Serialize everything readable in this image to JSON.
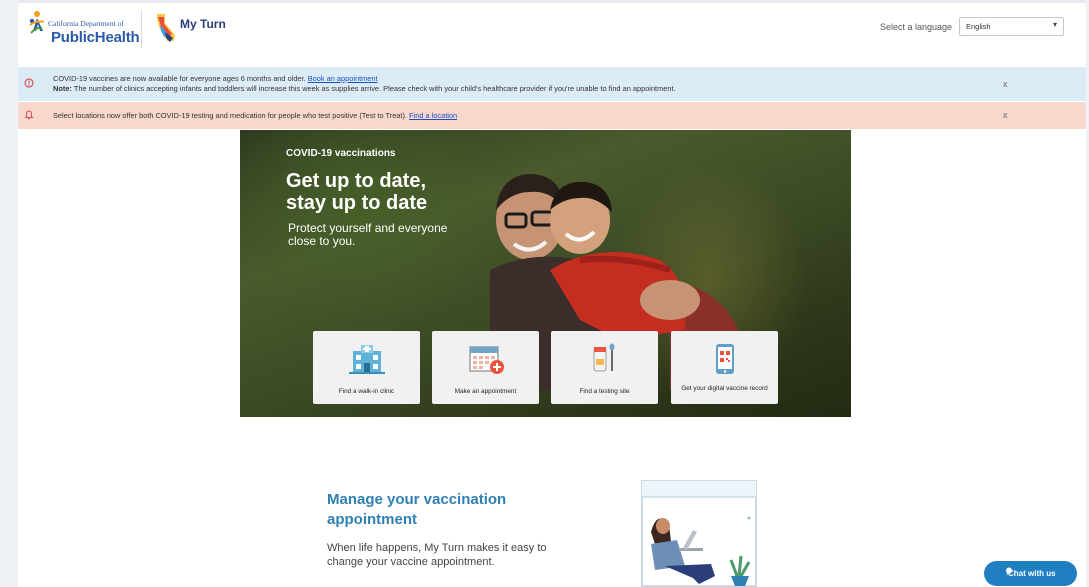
{
  "header": {
    "cdph_small": "California Department of",
    "cdph_big": "PublicHealth",
    "app_name": "My Turn",
    "language_label": "Select a language",
    "language_value": "English"
  },
  "alerts": [
    {
      "icon": "alert-circle-icon",
      "line1_text": "COVID-19 vaccines are now available for everyone ages 6 months and older.",
      "line1_link": "Book an appointment",
      "line2_bold": "Note:",
      "line2_text": "The number of clinics accepting infants and toddlers will increase this week as supplies arrive. Please check with your child's healthcare provider if you're unable to find an appointment.",
      "close": "x"
    },
    {
      "icon": "bell-icon",
      "text": "Select locations now offer both COVID-19 testing and medication for people who test positive (Test to Treat).",
      "link": "Find a location",
      "close": "x"
    }
  ],
  "hero": {
    "eyebrow": "COVID-19 vaccinations",
    "title": "Get up to date,\nstay up to date",
    "subtitle": "Protect yourself and everyone\nclose to you.",
    "actions": [
      {
        "label": "Find a walk-in clinic",
        "icon": "clinic-building-icon"
      },
      {
        "label": "Make an appointment",
        "icon": "calendar-add-icon"
      },
      {
        "label": "Find a testing site",
        "icon": "test-tube-icon"
      },
      {
        "label": "Get your digital vaccine record",
        "icon": "qr-phone-icon"
      }
    ]
  },
  "manage": {
    "title": "Manage your vaccination\nappointment",
    "text": "When life happens, My Turn makes it easy to\nchange your vaccine appointment."
  },
  "chat": {
    "label": "Chat with us"
  },
  "colors": {
    "brand_blue": "#2b5aa8",
    "alert_blue": "#dcecf7",
    "alert_salmon": "#f8d7cd",
    "manage_title": "#2f80b3",
    "chat_button": "#1f7fc2"
  }
}
